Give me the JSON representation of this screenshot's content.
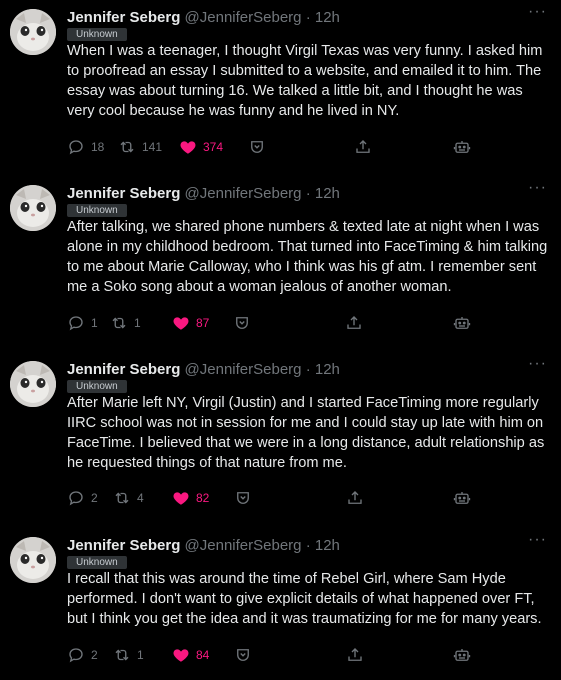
{
  "tweets": [
    {
      "name": "Jennifer Seberg",
      "handle": "@JenniferSeberg",
      "time": "· 12h",
      "tag": "Unknown",
      "text": "When I was a teenager, I thought Virgil Texas was very funny. I asked him to proofread an essay I submitted to a website, and emailed it to him. The essay was about turning 16. We talked a little bit, and I thought he was very cool because he was funny and he lived in NY.",
      "replies": "18",
      "retweets": "141",
      "likes": "374"
    },
    {
      "name": "Jennifer Seberg",
      "handle": "@JenniferSeberg",
      "time": "· 12h",
      "tag": "Unknown",
      "text": "After talking, we shared phone numbers & texted late at night when I was alone in my childhood bedroom. That turned into FaceTiming & him talking to me about Marie Calloway, who I think was his gf atm. I remember sent me a Soko song about a woman jealous of another woman.",
      "replies": "1",
      "retweets": "1",
      "likes": "87"
    },
    {
      "name": "Jennifer Seberg",
      "handle": "@JenniferSeberg",
      "time": "· 12h",
      "tag": "Unknown",
      "text": "After Marie left NY, Virgil (Justin) and I started FaceTiming more regularly IIRC school was not in session for me and I could stay up late with him on FaceTime. I believed that we were in a long distance, adult relationship as he requested things of that nature from me.",
      "replies": "2",
      "retweets": "4",
      "likes": "82"
    },
    {
      "name": "Jennifer Seberg",
      "handle": "@JenniferSeberg",
      "time": "· 12h",
      "tag": "Unknown",
      "text": "I recall that this was around the time of Rebel Girl, where Sam Hyde performed. I don't want to give explicit details of what happened over FT, but I think you get the idea and it was traumatizing for me for many years.",
      "replies": "2",
      "retweets": "1",
      "likes": "84"
    }
  ],
  "icons": {
    "more": "more-icon",
    "reply": "reply-icon",
    "retweet": "retweet-icon",
    "like": "heart-icon",
    "bookmark": "bookmark-icon",
    "share": "share-icon",
    "bot": "bot-icon"
  },
  "colors": {
    "background": "#000000",
    "text": "#e7e9ea",
    "muted": "#71767b",
    "like": "#f91880",
    "tag_bg": "#2f3336"
  }
}
